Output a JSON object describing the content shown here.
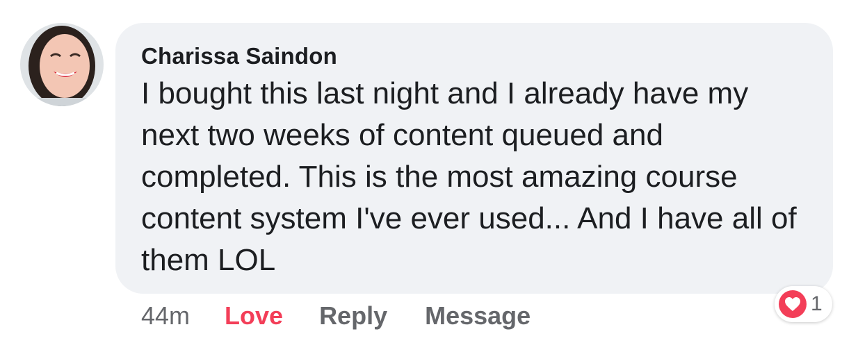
{
  "comment": {
    "author": "Charissa Saindon",
    "text": "I bought this last night and I already have my next two weeks of content queued and completed. This is the most amazing course content system I've ever used... And I have all of them LOL",
    "timestamp": "44m",
    "actions": {
      "love": "Love",
      "reply": "Reply",
      "message": "Message"
    },
    "reaction": {
      "icon": "heart-icon",
      "count": "1",
      "color": "#f33e58"
    }
  },
  "colors": {
    "bubble": "#f0f2f5",
    "text": "#1c1e21",
    "secondary": "#65676b",
    "love": "#f33e58"
  }
}
